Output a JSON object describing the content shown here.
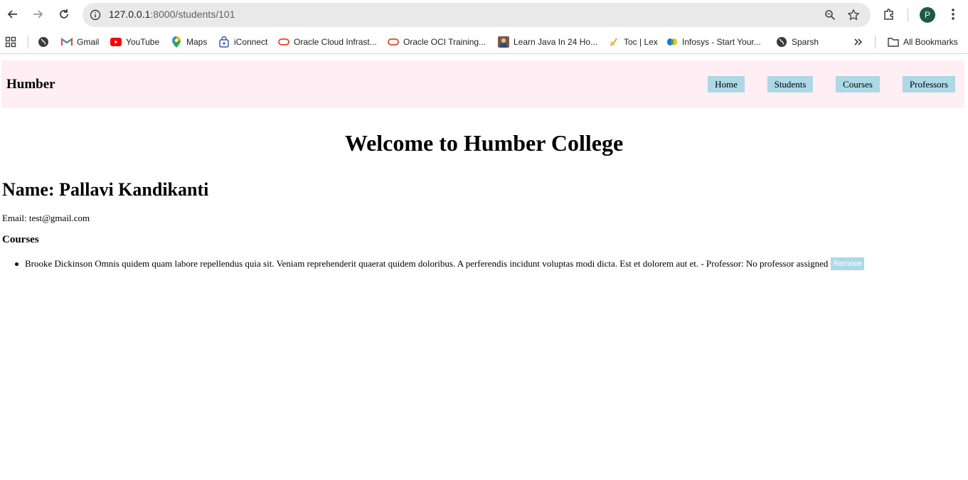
{
  "browser": {
    "url_host": "127.0.0.1",
    "url_path": ":8000/students/101",
    "profile_initial": "P",
    "bookmarks": [
      {
        "label": "Gmail",
        "icon": "gmail-icon"
      },
      {
        "label": "YouTube",
        "icon": "youtube-icon"
      },
      {
        "label": "Maps",
        "icon": "maps-icon"
      },
      {
        "label": "iConnect",
        "icon": "iconnect-icon"
      },
      {
        "label": "Oracle Cloud Infrast...",
        "icon": "oracle-icon"
      },
      {
        "label": "Oracle OCI Training...",
        "icon": "oracle-icon"
      },
      {
        "label": "Learn Java In 24 Ho...",
        "icon": "video-thumb-icon"
      },
      {
        "label": "Toc | Lex",
        "icon": "lex-icon"
      },
      {
        "label": "Infosys - Start Your...",
        "icon": "infosys-icon"
      },
      {
        "label": "Sparsh",
        "icon": "globe-icon"
      }
    ],
    "all_bookmarks_label": "All Bookmarks"
  },
  "header": {
    "brand": "Humber",
    "nav": [
      "Home",
      "Students",
      "Courses",
      "Professors"
    ]
  },
  "main": {
    "welcome": "Welcome to Humber College",
    "student_name": "Name: Pallavi Kandikanti",
    "email": "Email: test@gmail.com",
    "courses_heading": "Courses",
    "courses": [
      {
        "text": "Brooke Dickinson Omnis quidem quam labore repellendus quia sit. Veniam reprehenderit quaerat quidem doloribus. A perferendis incidunt voluptas modi dicta. Est et dolorem aut et. - Professor: No professor assigned",
        "action": "Remove"
      }
    ]
  },
  "colors": {
    "header_bg": "#ffeef3",
    "nav_button_bg": "#add8e6"
  }
}
